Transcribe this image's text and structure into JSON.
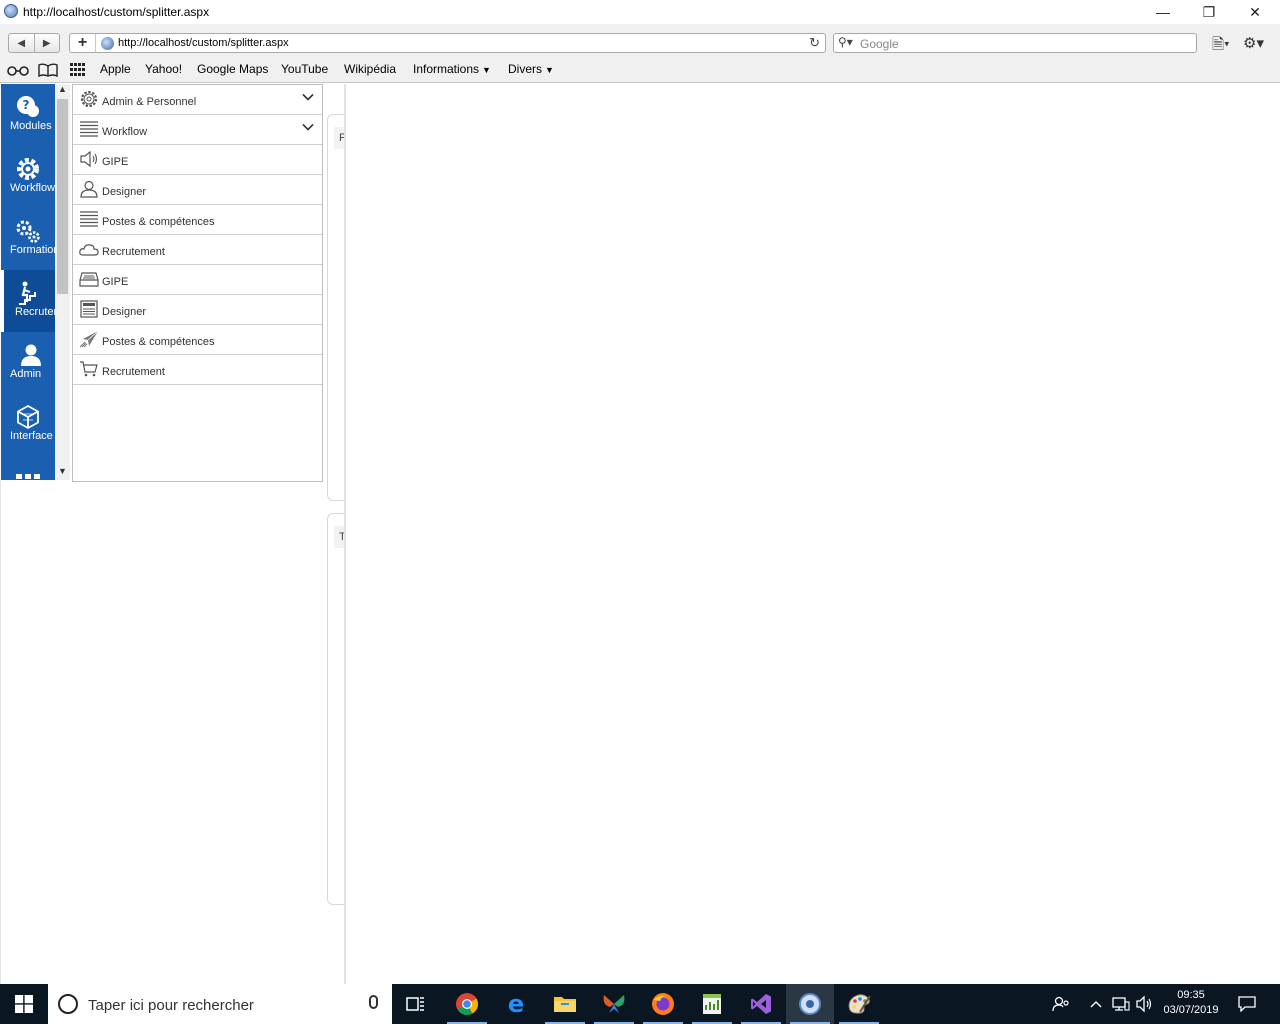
{
  "window": {
    "title": "http://localhost/custom/splitter.aspx",
    "minimize_glyph": "—",
    "restore_glyph": "❐",
    "close_glyph": "✕"
  },
  "toolbar": {
    "back_glyph": "◀",
    "forward_glyph": "▶",
    "new_tab_glyph": "+",
    "address": "http://localhost/custom/splitter.aspx",
    "reload_glyph": "↻",
    "search_placeholder": "Google",
    "search_glyph": "⚲▾",
    "page_menu_glyph": "🗎▾",
    "tools_menu_glyph": "⚙▾"
  },
  "bookmarks": {
    "icons": [
      "reading-glasses-icon",
      "book-icon",
      "apps-grid-icon"
    ],
    "items": [
      {
        "label": "Apple"
      },
      {
        "label": "Yahoo!"
      },
      {
        "label": "Google Maps"
      },
      {
        "label": "YouTube"
      },
      {
        "label": "Wikipédia"
      },
      {
        "label": "Informations",
        "dropdown": "▼"
      },
      {
        "label": "Divers",
        "dropdown": "▼"
      }
    ]
  },
  "modules": [
    {
      "label": "Modules",
      "icon": "help-bubble-icon",
      "active": false
    },
    {
      "label": "Workflow",
      "icon": "cog-icon",
      "active": false
    },
    {
      "label": "Formation",
      "icon": "cogs-icon",
      "active": false
    },
    {
      "label": "Recrutement",
      "icon": "stairs-person-icon",
      "active": true
    },
    {
      "label": "Admin",
      "icon": "user-icon",
      "active": false
    },
    {
      "label": "Interface",
      "icon": "cube-icon",
      "active": false
    }
  ],
  "scrollbar": {
    "up_glyph": "▲",
    "down_glyph": "▼"
  },
  "menu": {
    "items": [
      {
        "label": "Admin & Personnel",
        "icon": "gear-icon",
        "expandable": true
      },
      {
        "label": "Workflow",
        "icon": "list-icon",
        "expandable": true
      },
      {
        "label": "GIPE",
        "icon": "speaker-icon",
        "expandable": false
      },
      {
        "label": "Designer",
        "icon": "person-icon",
        "expandable": false
      },
      {
        "label": "Postes & compétences",
        "icon": "list-icon",
        "expandable": false
      },
      {
        "label": "Recrutement",
        "icon": "cloud-icon",
        "expandable": false
      },
      {
        "label": "GIPE",
        "icon": "inbox-icon",
        "expandable": false
      },
      {
        "label": "Designer",
        "icon": "newspaper-icon",
        "expandable": false
      },
      {
        "label": "Postes & compétences",
        "icon": "paper-plane-icon",
        "expandable": false
      },
      {
        "label": "Recrutement",
        "icon": "cart-icon",
        "expandable": false
      }
    ]
  },
  "panels": [
    {
      "header": "F"
    },
    {
      "header": "T"
    }
  ],
  "taskbar": {
    "search_placeholder": "Taper ici pour rechercher",
    "apps": [
      "task-view-icon",
      "chrome-icon",
      "edge-icon",
      "file-explorer-icon",
      "app-butterfly-icon",
      "firefox-icon",
      "spreadsheet-icon",
      "visual-studio-icon",
      "maxthon-browser-icon",
      "paint-icon"
    ],
    "time": "09:35",
    "date": "03/07/2019"
  }
}
